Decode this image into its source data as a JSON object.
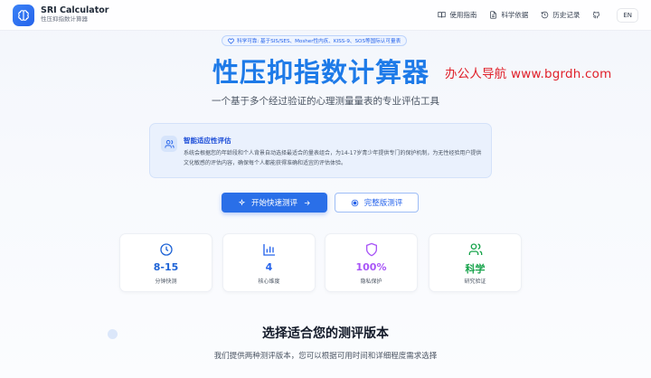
{
  "header": {
    "title": "SRI Calculator",
    "subtitle": "性压抑指数计算器",
    "nav": [
      {
        "label": "使用指南",
        "icon": "book-icon"
      },
      {
        "label": "科学依据",
        "icon": "document-icon"
      },
      {
        "label": "历史记录",
        "icon": "history-icon"
      }
    ],
    "lang": "EN"
  },
  "hero": {
    "badge": "科学可靠: 基于SIS/SES、Mosher性内疚、KISS-9、SOS等国际认可量表",
    "title": "性压抑指数计算器",
    "subtitle": "一个基于多个经过验证的心理测量量表的专业评估工具",
    "watermark": "办公人导航  www.bgrdh.com"
  },
  "info": {
    "title": "智能适应性评估",
    "text": "系统会根据您的年龄段和个人背景自动选择最适合的量表组合，为14-17岁青少年提供专门的保护机制，为无性经验用户提供文化敏感的评估内容，确保每个人都能获得准确和适宜的评估体验。"
  },
  "buttons": {
    "primary": "开始快速测评",
    "secondary": "完整版测评"
  },
  "stats": [
    {
      "value": "8-15",
      "label": "分钟快测",
      "color": "#1e63d6",
      "icon": "clock-icon"
    },
    {
      "value": "4",
      "label": "核心维度",
      "color": "#2563eb",
      "icon": "bar-chart-icon"
    },
    {
      "value": "100%",
      "label": "隐私保护",
      "color": "#a855f7",
      "icon": "shield-icon"
    },
    {
      "value": "科学",
      "label": "研究验证",
      "color": "#16a34a",
      "icon": "users-icon"
    }
  ],
  "section": {
    "title": "选择适合您的测评版本",
    "subtitle": "我们提供两种测评版本，您可以根据可用时间和详细程度需求选择"
  }
}
